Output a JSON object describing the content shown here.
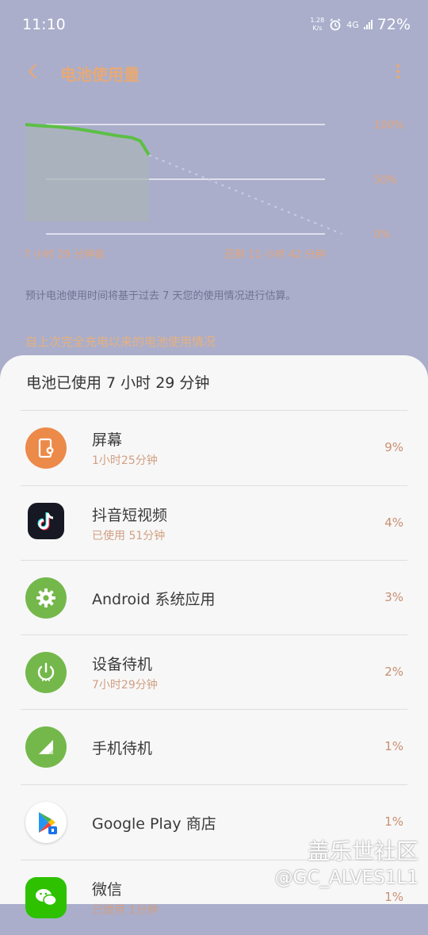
{
  "status_bar": {
    "time": "11:10",
    "speed_value": "1.28",
    "speed_unit": "K/s",
    "network": "4G",
    "battery": "72%"
  },
  "header": {
    "title": "电池使用量",
    "back_icon": "back-arrow-icon",
    "more_icon": "more-vert-icon"
  },
  "chart_data": {
    "type": "area",
    "x_start_label": "7 小时 29 分钟前",
    "x_end_label": "还剩 11 小时 42 分钟",
    "y_tick_labels": [
      "100%",
      "50%",
      "0%"
    ],
    "ylim": [
      0,
      100
    ],
    "series": [
      {
        "kind": "history",
        "values": [
          {
            "t": 0.0,
            "y": 100
          },
          {
            "t": 0.1,
            "y": 99
          },
          {
            "t": 0.25,
            "y": 98
          },
          {
            "t": 0.42,
            "y": 96
          },
          {
            "t": 0.58,
            "y": 93
          },
          {
            "t": 0.73,
            "y": 90
          },
          {
            "t": 0.86,
            "y": 88
          },
          {
            "t": 0.93,
            "y": 85
          },
          {
            "t": 1.0,
            "y": 72
          }
        ]
      },
      {
        "kind": "projection",
        "values": [
          {
            "t": 1.0,
            "y": 72
          },
          {
            "t": 2.56,
            "y": 0
          }
        ]
      }
    ],
    "colors": {
      "line": "#5cbf45",
      "fill": "#aab4b8",
      "grid": "#ffffff",
      "projection": "#cbcde0"
    }
  },
  "note": "预计电池使用时间将基于过去 7 天您的使用情况进行估算。",
  "section_title": "自上次完全充电以来的电池使用情况",
  "summary": "电池已使用 7 小时 29 分钟",
  "apps": [
    {
      "name": "屏幕",
      "sub": "1小时25分钟",
      "pct": "9%",
      "icon": "screen-settings-icon",
      "color": "#ec8a4a"
    },
    {
      "name": "抖音短视频",
      "sub": "已使用 51分钟",
      "pct": "4%",
      "icon": "tiktok-icon",
      "color": "#161823"
    },
    {
      "name": "Android 系统应用",
      "sub": "",
      "pct": "3%",
      "icon": "android-gear-icon",
      "color": "#74b84b"
    },
    {
      "name": "设备待机",
      "sub": "7小时29分钟",
      "pct": "2%",
      "icon": "power-standby-icon",
      "color": "#74b84b"
    },
    {
      "name": "手机待机",
      "sub": "",
      "pct": "1%",
      "icon": "cell-signal-icon",
      "color": "#74b84b"
    },
    {
      "name": "Google Play 商店",
      "sub": "",
      "pct": "1%",
      "icon": "google-play-icon",
      "color": "#ffffff"
    },
    {
      "name": "微信",
      "sub": "已使用 1分钟",
      "pct": "1%",
      "icon": "wechat-icon",
      "color": "#2dc100"
    }
  ],
  "watermark": {
    "line1": "盖乐世社区",
    "line2": "@GC_ALVES1L1"
  }
}
